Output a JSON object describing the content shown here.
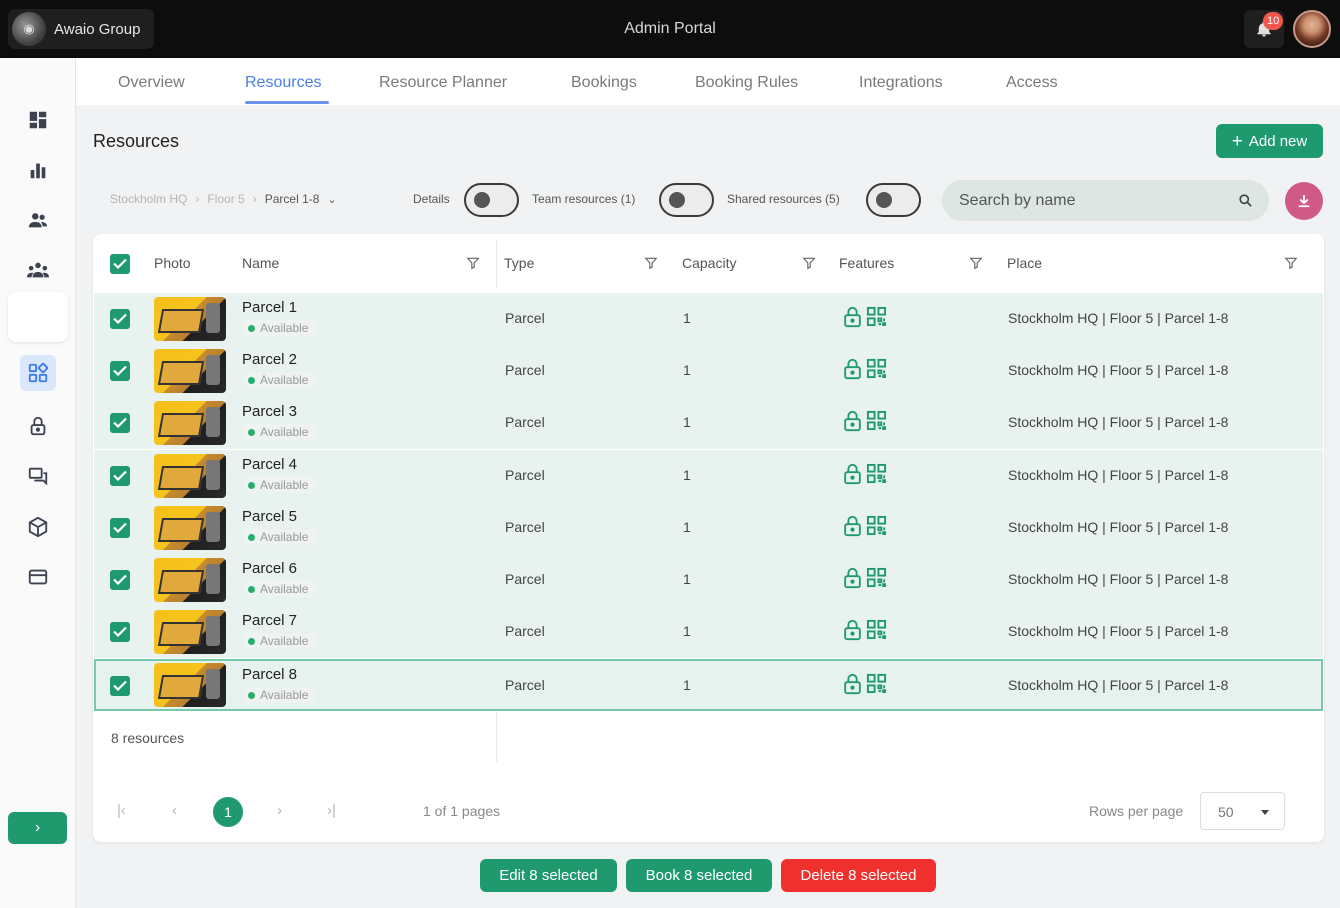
{
  "header": {
    "org_name": "Awaio Group",
    "portal_title": "Admin Portal",
    "notification_count": "10"
  },
  "sidebar": {
    "items": [
      {
        "icon": "dashboard-icon"
      },
      {
        "icon": "bar-chart-icon"
      },
      {
        "icon": "users-icon"
      },
      {
        "icon": "teams-icon"
      },
      {
        "icon": "buildings-icon"
      },
      {
        "icon": "resources-icon",
        "active": true
      },
      {
        "icon": "lock-icon"
      },
      {
        "icon": "chat-icon"
      },
      {
        "icon": "package-icon"
      },
      {
        "icon": "card-icon"
      }
    ],
    "expand_label": "›"
  },
  "tabs": [
    "Overview",
    "Resources",
    "Resource Planner",
    "Bookings",
    "Booking Rules",
    "Integrations",
    "Access"
  ],
  "active_tab": "Resources",
  "page": {
    "title": "Resources",
    "add_new_label": "Add new"
  },
  "breadcrumb": [
    "Stockholm HQ",
    "Floor 5",
    "Parcel 1-8"
  ],
  "toggles": {
    "details_label": "Details",
    "team_label": "Team resources (1)",
    "shared_label": "Shared resources (5)"
  },
  "search": {
    "placeholder": "Search by name"
  },
  "table": {
    "columns": [
      "Photo",
      "Name",
      "Type",
      "Capacity",
      "Features",
      "Place"
    ],
    "rows": [
      {
        "name": "Parcel 1",
        "status": "Available",
        "type": "Parcel",
        "capacity": "1",
        "place": "Stockholm HQ | Floor 5 | Parcel 1-8"
      },
      {
        "name": "Parcel 2",
        "status": "Available",
        "type": "Parcel",
        "capacity": "1",
        "place": "Stockholm HQ | Floor 5 | Parcel 1-8"
      },
      {
        "name": "Parcel 3",
        "status": "Available",
        "type": "Parcel",
        "capacity": "1",
        "place": "Stockholm HQ | Floor 5 | Parcel 1-8"
      },
      {
        "name": "Parcel 4",
        "status": "Available",
        "type": "Parcel",
        "capacity": "1",
        "place": "Stockholm HQ | Floor 5 | Parcel 1-8"
      },
      {
        "name": "Parcel 5",
        "status": "Available",
        "type": "Parcel",
        "capacity": "1",
        "place": "Stockholm HQ | Floor 5 | Parcel 1-8"
      },
      {
        "name": "Parcel 6",
        "status": "Available",
        "type": "Parcel",
        "capacity": "1",
        "place": "Stockholm HQ | Floor 5 | Parcel 1-8"
      },
      {
        "name": "Parcel 7",
        "status": "Available",
        "type": "Parcel",
        "capacity": "1",
        "place": "Stockholm HQ | Floor 5 | Parcel 1-8"
      },
      {
        "name": "Parcel 8",
        "status": "Available",
        "type": "Parcel",
        "capacity": "1",
        "place": "Stockholm HQ | Floor 5 | Parcel 1-8"
      }
    ],
    "count_label": "8 resources"
  },
  "pagination": {
    "current_page": "1",
    "pages_text": "1 of 1 pages",
    "rows_per_page_label": "Rows per page",
    "rows_per_page": "50"
  },
  "actions": {
    "edit_label": "Edit 8 selected",
    "book_label": "Book 8 selected",
    "delete_label": "Delete 8 selected"
  },
  "colors": {
    "accent": "#1f9a6e",
    "link": "#4a7ee8",
    "danger": "#f0302c",
    "download": "#d05a86"
  }
}
